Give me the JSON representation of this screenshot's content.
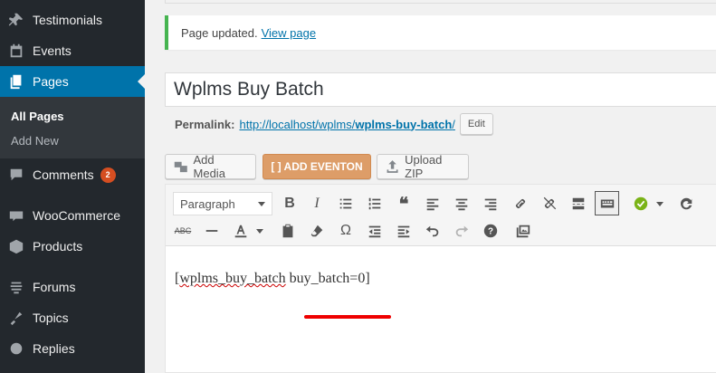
{
  "sidebar": {
    "items": [
      {
        "label": "Testimonials",
        "icon": "pin-icon"
      },
      {
        "label": "Events",
        "icon": "calendar-icon"
      },
      {
        "label": "Pages",
        "icon": "pages-icon",
        "active": true
      },
      {
        "label": "Comments",
        "icon": "comment-icon",
        "badge": "2"
      },
      {
        "label": "WooCommerce",
        "icon": "woo-icon"
      },
      {
        "label": "Products",
        "icon": "box-icon"
      },
      {
        "label": "Forums",
        "icon": "forums-icon"
      },
      {
        "label": "Topics",
        "icon": "topics-icon"
      },
      {
        "label": "Replies",
        "icon": "replies-icon"
      }
    ],
    "submenu": [
      "All Pages",
      "Add New"
    ]
  },
  "notice": {
    "text": "Page updated.",
    "link": "View page"
  },
  "title": "Wplms Buy Batch",
  "permalink": {
    "label": "Permalink:",
    "url_prefix": "http://localhost/wplms/",
    "slug": "wplms-buy-batch",
    "url_suffix": "/",
    "edit": "Edit"
  },
  "media_buttons": {
    "add_media": "Add Media",
    "add_eventon": "[ ] ADD EVENTON",
    "upload_zip": "Upload ZIP"
  },
  "toolbar": {
    "format": "Paragraph"
  },
  "content": {
    "part1": "[",
    "spell": "wplms_buy_batch",
    "part2": " buy_batch=0]"
  },
  "colors": {
    "accent": "#0073aa",
    "sidebar": "#23282d",
    "notice": "#46b450",
    "eventon": "#dd9d68"
  }
}
